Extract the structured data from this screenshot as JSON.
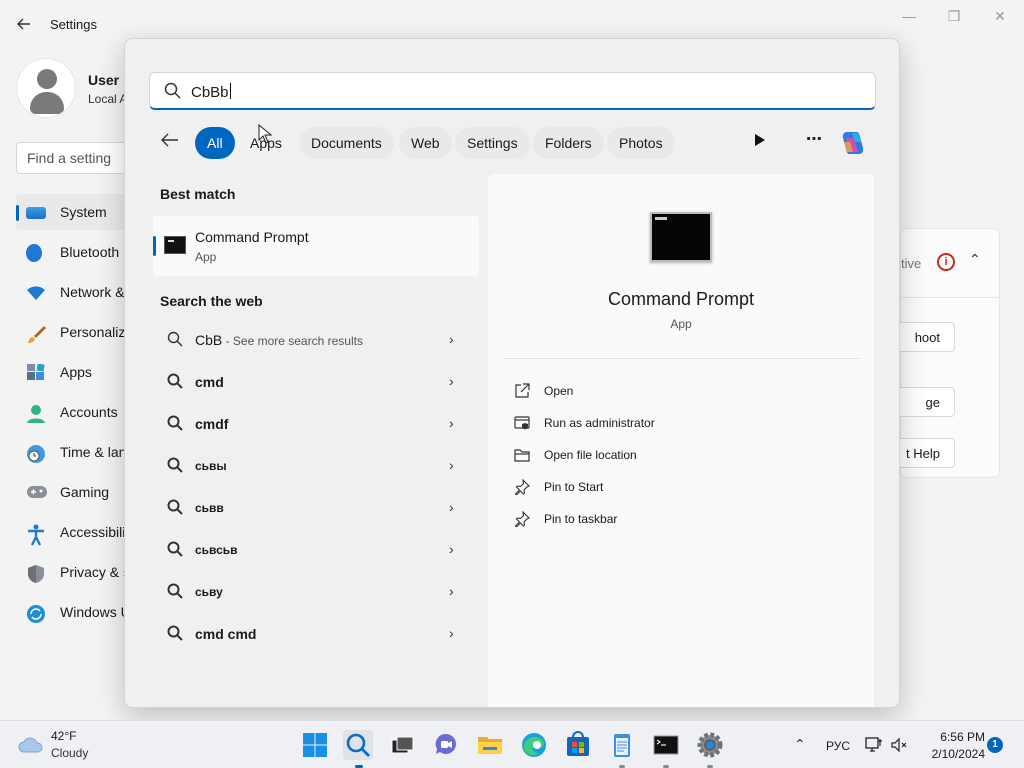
{
  "settings": {
    "title": "Settings",
    "user": {
      "name": "User",
      "sub": "Local A"
    },
    "find_placeholder": "Find a setting",
    "nav": [
      {
        "label": "System",
        "icon": "system-icon"
      },
      {
        "label": "Bluetooth",
        "icon": "bluetooth-icon"
      },
      {
        "label": "Network &",
        "icon": "network-icon"
      },
      {
        "label": "Personaliz",
        "icon": "brush-icon"
      },
      {
        "label": "Apps",
        "icon": "apps-icon"
      },
      {
        "label": "Accounts",
        "icon": "accounts-icon"
      },
      {
        "label": "Time & lan",
        "icon": "clock-icon"
      },
      {
        "label": "Gaming",
        "icon": "gamepad-icon"
      },
      {
        "label": "Accessibilit",
        "icon": "accessibility-icon"
      },
      {
        "label": "Privacy & s",
        "icon": "shield-icon"
      },
      {
        "label": "Windows U",
        "icon": "update-icon"
      }
    ],
    "right_card": {
      "status": "tive",
      "buttons": [
        "hoot",
        "ge",
        "t Help"
      ]
    }
  },
  "search": {
    "query": "СbВb",
    "filters": [
      "All",
      "Apps",
      "Documents",
      "Web",
      "Settings",
      "Folders",
      "Photos"
    ],
    "best_match_heading": "Best match",
    "best_match": {
      "title": "Command Prompt",
      "type": "App"
    },
    "web_heading": "Search the web",
    "web_results": [
      {
        "text": "СbВ",
        "sub": " - See more search results",
        "bold": false
      },
      {
        "text": "cmd",
        "sub": "",
        "bold": true
      },
      {
        "text": "cmdf",
        "sub": "",
        "bold": true
      },
      {
        "text": "сьвы",
        "sub": "",
        "bold": true
      },
      {
        "text": "сьвв",
        "sub": "",
        "bold": true
      },
      {
        "text": "сьвсьв",
        "sub": "",
        "bold": true
      },
      {
        "text": "сьву",
        "sub": "",
        "bold": true
      },
      {
        "text": "cmd cmd",
        "sub": "",
        "bold": true
      }
    ],
    "preview": {
      "title": "Command Prompt",
      "type": "App",
      "actions": [
        {
          "label": "Open",
          "icon": "open-external-icon"
        },
        {
          "label": "Run as administrator",
          "icon": "admin-shield-icon"
        },
        {
          "label": "Open file location",
          "icon": "folder-icon"
        },
        {
          "label": "Pin to Start",
          "icon": "pin-icon"
        },
        {
          "label": "Pin to taskbar",
          "icon": "pin-icon"
        }
      ]
    }
  },
  "taskbar": {
    "weather": {
      "temp": "42°F",
      "condition": "Cloudy"
    },
    "apps": [
      "start",
      "search",
      "task-view",
      "chat",
      "file-explorer",
      "edge",
      "store",
      "notepad",
      "terminal",
      "settings"
    ],
    "tray": {
      "lang": "РУС",
      "time": "6:56 PM",
      "date": "2/10/2024",
      "notifications": "1"
    },
    "colors": {
      "accent": "#0067c0"
    }
  }
}
